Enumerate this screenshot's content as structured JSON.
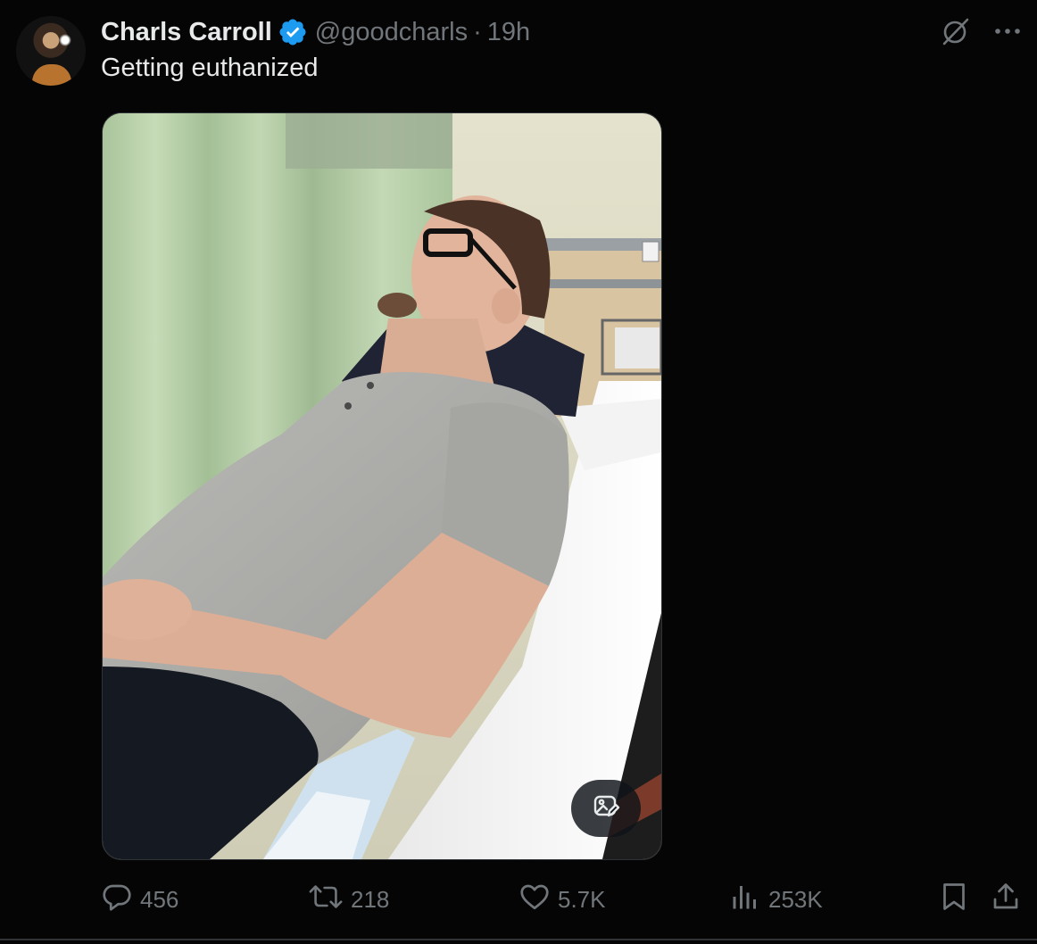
{
  "tweet": {
    "author_name": "Charls Carroll",
    "handle": "@goodcharls",
    "separator": "·",
    "time": "19h",
    "text": "Getting euthanized",
    "verified": true,
    "accent_color": "#1d9bf0"
  },
  "actions": {
    "replies": "456",
    "reposts": "218",
    "likes": "5.7K",
    "views": "253K"
  },
  "icons": {
    "reply": "reply-icon",
    "repost": "repost-icon",
    "like": "heart-icon",
    "views": "views-icon",
    "bookmark": "bookmark-icon",
    "share": "share-icon",
    "grok": "grok-icon",
    "more": "more-icon",
    "edit_image": "edit-image-icon"
  }
}
